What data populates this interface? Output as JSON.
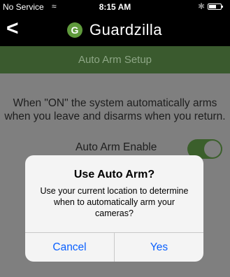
{
  "status_bar": {
    "carrier": "No Service",
    "wifi_icon": "wifi-icon",
    "time": "8:15 AM",
    "bluetooth_icon": "bluetooth-icon",
    "battery_icon": "battery-icon"
  },
  "nav": {
    "back_icon": "chevron-left-icon",
    "back_glyph": "<",
    "logo_letter": "G",
    "app_name": "Guardzilla"
  },
  "page": {
    "title": "Auto Arm Setup"
  },
  "settings": {
    "description": "When \"ON\" the system automatically arms when you leave and disarms when you return.",
    "auto_arm_label": "Auto Arm Enable",
    "auto_arm_enabled": true
  },
  "alert": {
    "title": "Use Auto Arm?",
    "message": "Use your current location to determine when to automatically arm your cameras?",
    "cancel_label": "Cancel",
    "confirm_label": "Yes"
  },
  "colors": {
    "brand_green": "#5f9a3c",
    "title_bar_green": "#3a5a2e",
    "ios_blue": "#0a60ff",
    "dim_overlay": "#7f7f7f"
  }
}
